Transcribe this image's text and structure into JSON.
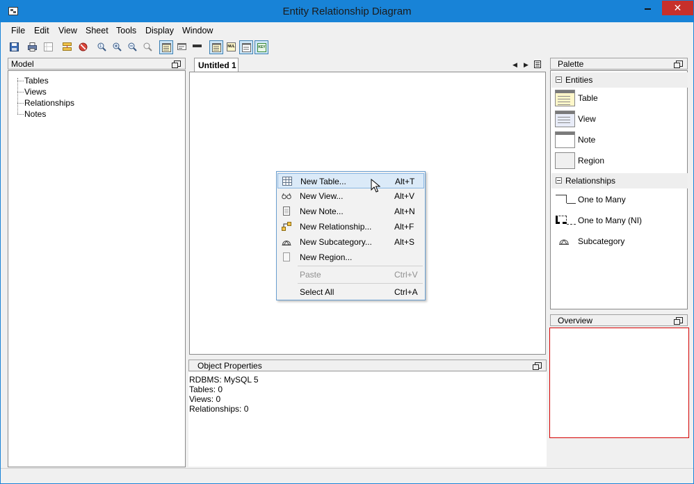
{
  "window": {
    "title": "Entity Relationship Diagram"
  },
  "menubar": {
    "items": [
      "File",
      "Edit",
      "View",
      "Sheet",
      "Tools",
      "Display",
      "Window"
    ]
  },
  "toolbar": {
    "buttons": [
      {
        "icon": "save-icon",
        "pressed": false
      },
      {
        "icon": "print-icon",
        "pressed": false
      },
      {
        "icon": "page-setup-icon",
        "pressed": false
      },
      {
        "icon": "layout-icon",
        "pressed": false
      },
      {
        "icon": "stop-icon",
        "pressed": false
      },
      {
        "icon": "zoom-fit-icon",
        "pressed": false
      },
      {
        "icon": "zoom-in-icon",
        "pressed": false
      },
      {
        "icon": "zoom-out-icon",
        "pressed": false
      },
      {
        "icon": "zoom-reset-icon",
        "pressed": false
      },
      {
        "icon": "show-columns-icon",
        "pressed": true
      },
      {
        "icon": "show-datatypes-icon",
        "pressed": false
      },
      {
        "icon": "show-title-only-icon",
        "pressed": false
      },
      {
        "icon": "show-table-icon",
        "pressed": true
      },
      {
        "icon": "null-icon",
        "pressed": false
      },
      {
        "icon": "show-keys-icon",
        "pressed": true
      },
      {
        "icon": "show-relationships-icon",
        "pressed": true
      }
    ],
    "null_label": "NUL",
    "keys_label": "KEY"
  },
  "model": {
    "header": "Model",
    "tree": [
      "Tables",
      "Views",
      "Relationships",
      "Notes"
    ]
  },
  "editor": {
    "tab_label": "Untitled 1"
  },
  "context_menu": {
    "items": [
      {
        "label": "New Table...",
        "accel": "Alt+T",
        "icon": "table-icon",
        "hover": true,
        "disabled": false
      },
      {
        "label": "New View...",
        "accel": "Alt+V",
        "icon": "glasses-icon",
        "hover": false,
        "disabled": false
      },
      {
        "label": "New Note...",
        "accel": "Alt+N",
        "icon": "note-icon",
        "hover": false,
        "disabled": false
      },
      {
        "label": "New Relationship...",
        "accel": "Alt+F",
        "icon": "relationship-icon",
        "hover": false,
        "disabled": false
      },
      {
        "label": "New Subcategory...",
        "accel": "Alt+S",
        "icon": "subcategory-icon",
        "hover": false,
        "disabled": false
      },
      {
        "label": "New Region...",
        "accel": "",
        "icon": "region-icon",
        "hover": false,
        "disabled": false
      },
      {
        "label": "Paste",
        "accel": "Ctrl+V",
        "icon": "",
        "hover": false,
        "disabled": true
      },
      {
        "label": "Select All",
        "accel": "Ctrl+A",
        "icon": "",
        "hover": false,
        "disabled": false
      }
    ]
  },
  "object_properties": {
    "header": "Object Properties",
    "lines": [
      "RDBMS: MySQL 5",
      "Tables: 0",
      "Views: 0",
      "Relationships: 0"
    ]
  },
  "palette": {
    "header": "Palette",
    "sections": [
      {
        "label": "Entities",
        "items": [
          "Table",
          "View",
          "Note",
          "Region"
        ]
      },
      {
        "label": "Relationships",
        "items": [
          "One to Many",
          "One to Many (NI)",
          "Subcategory"
        ]
      }
    ]
  },
  "overview": {
    "header": "Overview"
  },
  "colors": {
    "titlebar": "#1883d7",
    "close_button": "#c7302b",
    "menu_hover": "#dbeaf8",
    "overview_border": "#d40000"
  }
}
